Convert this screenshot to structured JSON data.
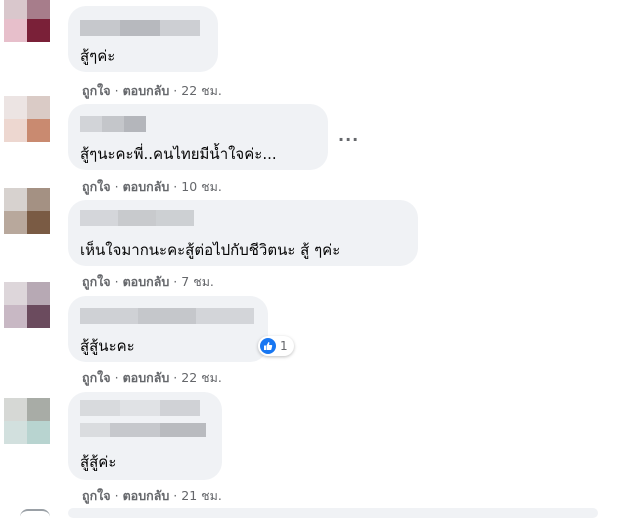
{
  "actions": {
    "like": "ถูกใจ",
    "reply": "ตอบกลับ",
    "dot": "·"
  },
  "comments": [
    {
      "text": "สู้ๆค่ะ",
      "time": "22 ชม."
    },
    {
      "text": "สู้ๆนะคะพี่..คนไทยมีน้ำใจค่ะ...",
      "time": "10 ชม.",
      "more": "..."
    },
    {
      "text": "เห็นใจมากนะคะสู้ต่อไปกับชีวิตนะ สู้ ๆค่ะ",
      "time": "7 ชม."
    },
    {
      "text": "สู้สู้นะคะ",
      "time": "22 ชม.",
      "reaction_count": "1"
    },
    {
      "text": "สู้สู้ค่ะ",
      "time": "21 ชม."
    }
  ],
  "colors": {
    "like_blue": "#1877f2",
    "bubble": "#f0f2f5",
    "meta_gray": "#65676b"
  }
}
